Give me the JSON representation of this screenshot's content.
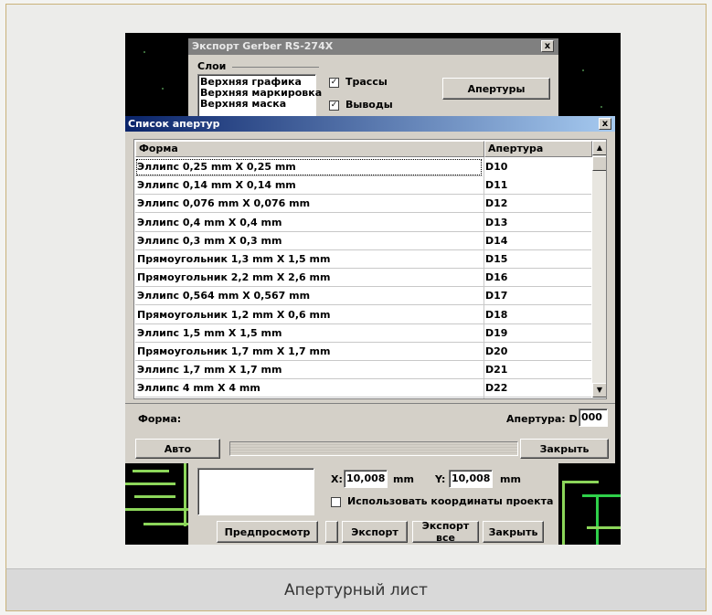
{
  "caption": "Апертурный лист",
  "back_dialog": {
    "title": "Экспорт Gerber RS-274X",
    "close_glyph": "x",
    "layers_group": "Слои",
    "layers": [
      "Верхняя графика",
      "Верхняя маркировка",
      "Верхняя маска"
    ],
    "checks": [
      {
        "label": "Трассы",
        "checked": true
      },
      {
        "label": "Выводы",
        "checked": true
      }
    ],
    "check_glyph": "✓",
    "apertures_button": "Апертуры",
    "x_label": "X:",
    "x_value": "10,008",
    "x_unit": "mm",
    "y_label": "Y:",
    "y_value": "10,008",
    "y_unit": "mm",
    "project_coords": "Использовать координаты проекта",
    "buttons": {
      "preview": "Предпросмотр",
      "export": "Экспорт",
      "export_all": "Экспорт все",
      "close": "Закрыть"
    }
  },
  "aperture_dialog": {
    "title": "Список апертур",
    "close_glyph": "x",
    "columns": [
      "Форма",
      "Апертура"
    ],
    "rows": [
      {
        "shape": "Эллипс 0,25 mm  X  0,25 mm",
        "aperture": "D10"
      },
      {
        "shape": "Эллипс 0,14 mm  X  0,14 mm",
        "aperture": "D11"
      },
      {
        "shape": "Эллипс 0,076 mm  X  0,076 mm",
        "aperture": "D12"
      },
      {
        "shape": "Эллипс 0,4 mm  X  0,4 mm",
        "aperture": "D13"
      },
      {
        "shape": "Эллипс 0,3 mm  X  0,3 mm",
        "aperture": "D14"
      },
      {
        "shape": "Прямоугольник 1,3 mm  X  1,5 mm",
        "aperture": "D15"
      },
      {
        "shape": "Прямоугольник 2,2 mm  X  2,6 mm",
        "aperture": "D16"
      },
      {
        "shape": "Эллипс 0,564 mm  X  0,567 mm",
        "aperture": "D17"
      },
      {
        "shape": "Прямоугольник 1,2 mm  X  0,6 mm",
        "aperture": "D18"
      },
      {
        "shape": "Эллипс 1,5 mm  X  1,5 mm",
        "aperture": "D19"
      },
      {
        "shape": "Прямоугольник 1,7 mm  X  1,7 mm",
        "aperture": "D20"
      },
      {
        "shape": "Эллипс 1,7 mm  X  1,7 mm",
        "aperture": "D21"
      },
      {
        "shape": "Эллипс 4 mm  X  4 mm",
        "aperture": "D22"
      }
    ],
    "shape_label": "Форма:",
    "aperture_label": "Апертура: D",
    "aperture_value": "000",
    "auto_button": "Авто",
    "close_button": "Закрыть",
    "scroll_up_glyph": "▲",
    "scroll_down_glyph": "▼"
  },
  "colors": {
    "pcb_trace": "#8cd65a",
    "title_active": "#0a246a",
    "title_inactive": "#808080",
    "dialog_face": "#d4d0c8"
  }
}
